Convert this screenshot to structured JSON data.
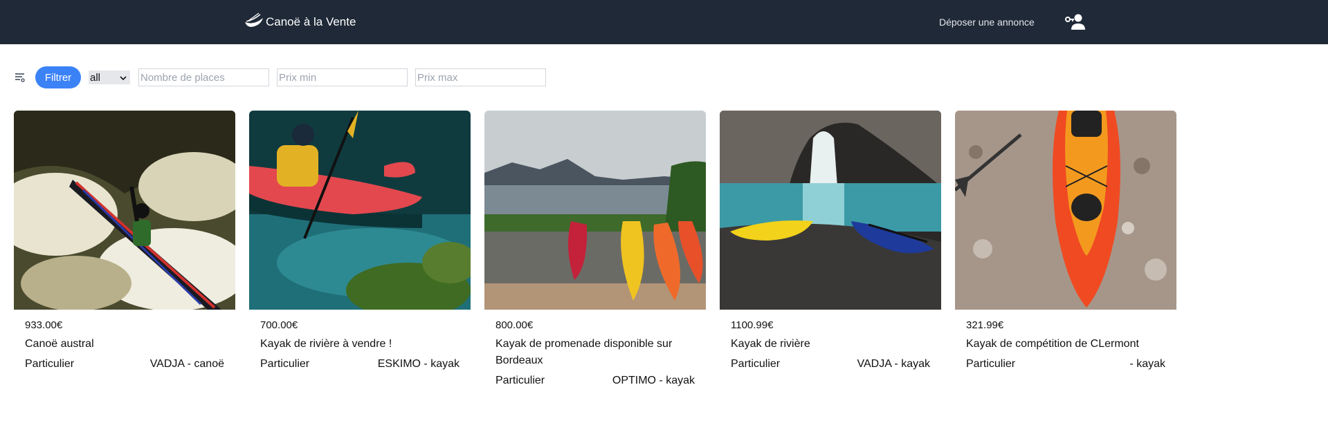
{
  "header": {
    "logo_icon": "canoe-icon",
    "brand": "Canoë à la Vente",
    "post_ad_link": "Déposer une annonce",
    "user_icon": "user-key-icon",
    "background": "#1f2937"
  },
  "filters": {
    "filter_icon": "filter-list-icon",
    "filter_button": "Filtrer",
    "type_value": "all",
    "places_placeholder": "Nombre de places",
    "min_price_placeholder": "Prix min",
    "max_price_placeholder": "Prix max",
    "accent": "#3b82f6"
  },
  "listings": [
    {
      "price": "933.00€",
      "title": "Canoë austral",
      "seller": "Particulier",
      "brand_type": "VADJA - canoë",
      "photo": "whitewater-kayaker-photo"
    },
    {
      "price": "700.00€",
      "title": "Kayak de rivière à vendre !",
      "seller": "Particulier",
      "brand_type": "ESKIMO - kayak",
      "photo": "red-kayak-paddler-photo"
    },
    {
      "price": "800.00€",
      "title": "Kayak de promenade disponible sur Bordeaux",
      "seller": "Particulier",
      "brand_type": "OPTIMO - kayak",
      "photo": "lake-kayaks-photo"
    },
    {
      "price": "1100.99€",
      "title": "Kayak de rivière",
      "seller": "Particulier",
      "brand_type": "VADJA - kayak",
      "photo": "sea-cave-kayaks-photo"
    },
    {
      "price": "321.99€",
      "title": "Kayak de compétition de CLermont",
      "seller": "Particulier",
      "brand_type": " - kayak",
      "photo": "orange-kayak-gravel-photo"
    }
  ]
}
